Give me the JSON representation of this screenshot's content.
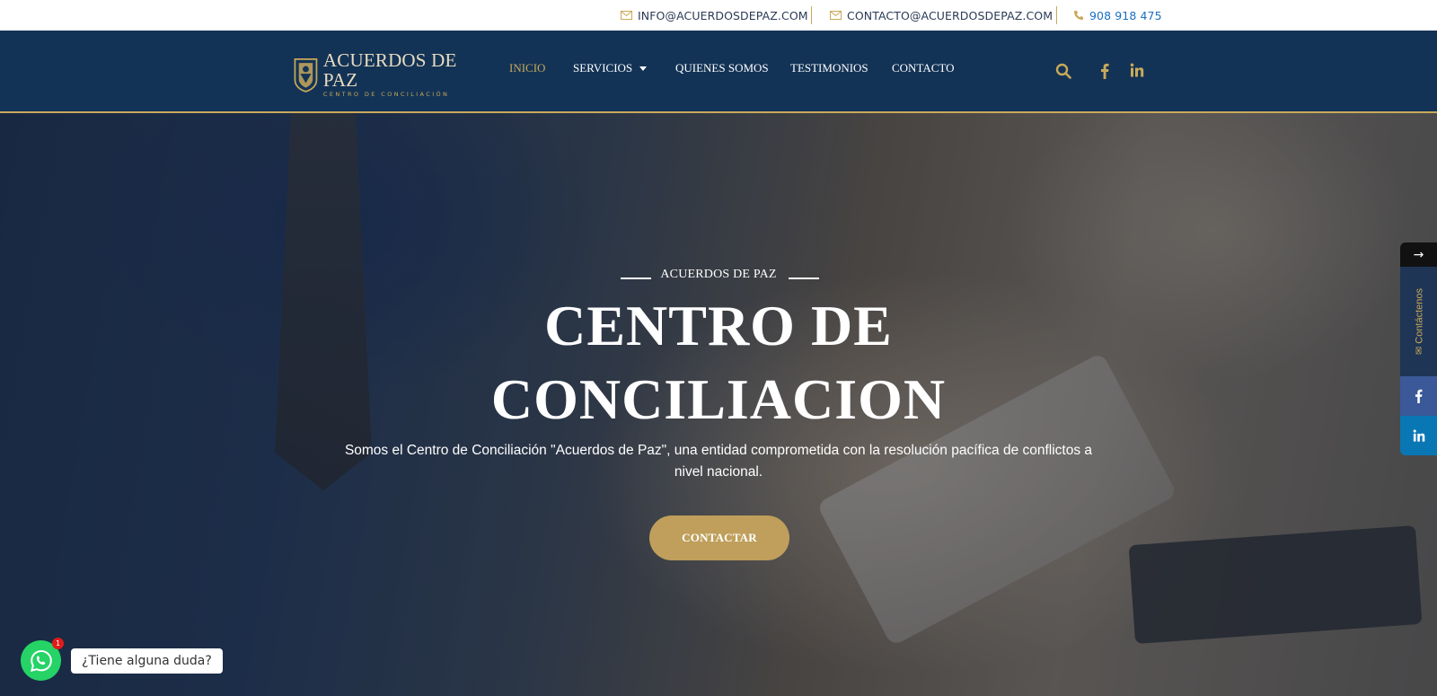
{
  "topbar": {
    "email1": "INFO@ACUERDOSDEPAZ.COM",
    "email2": "CONTACTO@ACUERDOSDEPAZ.COM",
    "phone": "908 918 475",
    "icon_email": "envelope-icon",
    "icon_phone": "phone-icon"
  },
  "logo": {
    "brand": "ACUERDOS DE PAZ",
    "sub": "CENTRO DE CONCILIACIÓN",
    "icon": "shield-emblem-icon"
  },
  "nav": {
    "items": [
      {
        "label": "INICIO",
        "active": true
      },
      {
        "label": "SERVICIOS",
        "dropdown": true
      },
      {
        "label": "QUIENES SOMOS"
      },
      {
        "label": "TESTIMONIOS"
      },
      {
        "label": "CONTACTO"
      }
    ],
    "icons": [
      "search-icon",
      "facebook-icon",
      "linkedin-icon"
    ]
  },
  "hero": {
    "eyebrow": "ACUERDOS DE PAZ",
    "title_line1": "CENTRO DE",
    "title_line2": "CONCILIACION",
    "description": "Somos el Centro de Conciliación \"Acuerdos de Paz\", una entidad comprometida con la resolución pacífica de conflictos a nivel nacional.",
    "cta": "CONTACTAR"
  },
  "side_panel": {
    "arrow": "→",
    "contact_label": "Contáctenos",
    "icons": [
      "arrow-right-icon",
      "envelope-icon",
      "facebook-icon",
      "linkedin-icon"
    ]
  },
  "whatsapp": {
    "badge": "1",
    "bubble": "¿Tiene alguna duda?",
    "icon": "whatsapp-icon"
  },
  "colors": {
    "navy": "#133356",
    "gold": "#c9a95a",
    "cta": "#bf9f5b",
    "phone_blue": "#1a6fc4"
  }
}
